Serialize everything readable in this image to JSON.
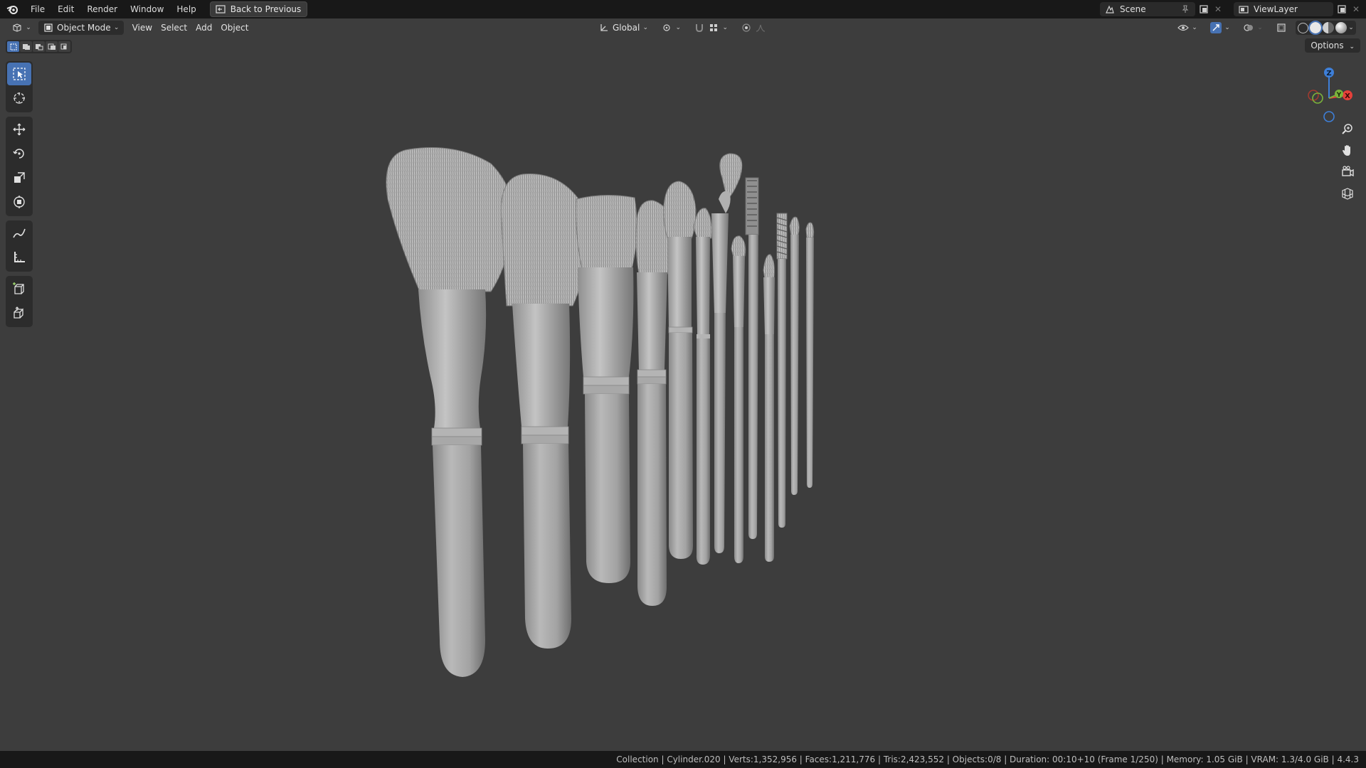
{
  "menu": {
    "logo": "blender-logo-icon",
    "items": [
      "File",
      "Edit",
      "Render",
      "Window",
      "Help"
    ],
    "back_button": "Back to Previous"
  },
  "top_right": {
    "scene_label": "Scene",
    "viewlayer_label": "ViewLayer"
  },
  "viewport_header": {
    "mode": "Object Mode",
    "menus": [
      "View",
      "Select",
      "Add",
      "Object"
    ],
    "transform_orientation": "Global",
    "options": "Options"
  },
  "gizmo": {
    "z": "Z",
    "y": "Y",
    "x": "X"
  },
  "status": {
    "text": "Collection | Cylinder.020 | Verts:1,352,956 | Faces:1,211,776 | Tris:2,423,552 | Objects:0/8 | Duration: 00:10+10 (Frame 1/250) | Memory: 1.05 GiB | VRAM: 1.3/4.0 GiB | 4.4.3"
  },
  "colors": {
    "active_blue": "#4772b3",
    "viewport_bg": "#3d3d3d",
    "axis_x": "#e5403a",
    "axis_y": "#7bb33b",
    "axis_z": "#3e7fd8"
  }
}
